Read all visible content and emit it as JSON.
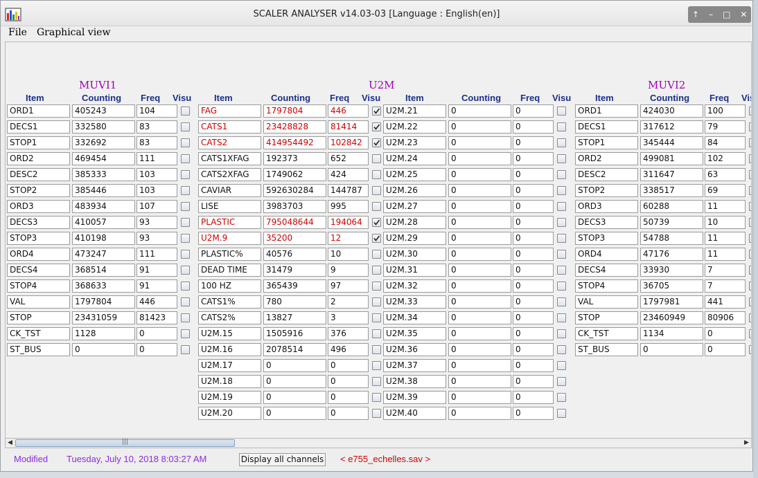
{
  "window": {
    "title": "SCALER ANALYSER v14.03-03 [Language : English(en)]"
  },
  "menu": {
    "file": "File",
    "graphical_view": "Graphical view"
  },
  "groups": [
    {
      "title": "MUVI1",
      "headers": {
        "item": "Item",
        "counting": "Counting",
        "freq": "Freq",
        "visu": "Visu"
      }
    },
    {
      "title": "U2M",
      "headers": {
        "item": "Item",
        "counting": "Counting",
        "freq": "Freq",
        "visu": "Visu"
      },
      "headers2": {
        "item": "Item",
        "counting": "Counting",
        "freq": "Freq",
        "visu": "Visu"
      }
    },
    {
      "title": "MUVI2",
      "headers": {
        "item": "Item",
        "counting": "Counting",
        "freq": "Freq",
        "visu": "Visu"
      }
    }
  ],
  "colors": {
    "highlight": "#d00000",
    "group_title": "#a000b8",
    "header": "#1a2f8c",
    "status_date": "#8a2be2",
    "filename": "#d00000"
  },
  "muvi1": [
    {
      "item": "ORD1",
      "counting": "405243",
      "freq": "104",
      "visu": false
    },
    {
      "item": "DECS1",
      "counting": "332580",
      "freq": "83",
      "visu": false
    },
    {
      "item": "STOP1",
      "counting": "332692",
      "freq": "83",
      "visu": false
    },
    {
      "item": "ORD2",
      "counting": "469454",
      "freq": "111",
      "visu": false
    },
    {
      "item": "DESC2",
      "counting": "385333",
      "freq": "103",
      "visu": false
    },
    {
      "item": "STOP2",
      "counting": "385446",
      "freq": "103",
      "visu": false
    },
    {
      "item": "ORD3",
      "counting": "483934",
      "freq": "107",
      "visu": false
    },
    {
      "item": "DECS3",
      "counting": "410057",
      "freq": "93",
      "visu": false
    },
    {
      "item": "STOP3",
      "counting": "410198",
      "freq": "93",
      "visu": false
    },
    {
      "item": "ORD4",
      "counting": "473247",
      "freq": "111",
      "visu": false
    },
    {
      "item": "DECS4",
      "counting": "368514",
      "freq": "91",
      "visu": false
    },
    {
      "item": "STOP4",
      "counting": "368633",
      "freq": "91",
      "visu": false
    },
    {
      "item": "VAL",
      "counting": "1797804",
      "freq": "446",
      "visu": false
    },
    {
      "item": "STOP",
      "counting": "23431059",
      "freq": "81423",
      "visu": false
    },
    {
      "item": "CK_TST",
      "counting": "1128",
      "freq": "0",
      "visu": false
    },
    {
      "item": "ST_BUS",
      "counting": "0",
      "freq": "0",
      "visu": false
    }
  ],
  "u2m_a": [
    {
      "item": "FAG",
      "counting": "1797804",
      "freq": "446",
      "visu": true,
      "red": true
    },
    {
      "item": "CATS1",
      "counting": "23428828",
      "freq": "81414",
      "visu": true,
      "red": true
    },
    {
      "item": "CATS2",
      "counting": "414954492",
      "freq": "102842",
      "visu": true,
      "red": true
    },
    {
      "item": "CATS1XFAG",
      "counting": "192373",
      "freq": "652",
      "visu": false
    },
    {
      "item": "CATS2XFAG",
      "counting": "1749062",
      "freq": "424",
      "visu": false
    },
    {
      "item": "CAVIAR",
      "counting": "592630284",
      "freq": "144787",
      "visu": false
    },
    {
      "item": "LISE",
      "counting": "3983703",
      "freq": "995",
      "visu": false
    },
    {
      "item": "PLASTIC",
      "counting": "795048644",
      "freq": "194064",
      "visu": true,
      "red": true
    },
    {
      "item": "U2M.9",
      "counting": "35200",
      "freq": "12",
      "visu": true,
      "red": true
    },
    {
      "item": "PLASTIC%",
      "counting": "40576",
      "freq": "10",
      "visu": false
    },
    {
      "item": "DEAD TIME",
      "counting": "31479",
      "freq": "9",
      "visu": false
    },
    {
      "item": "100 HZ",
      "counting": "365439",
      "freq": "97",
      "visu": false
    },
    {
      "item": "CATS1%",
      "counting": "780",
      "freq": "2",
      "visu": false
    },
    {
      "item": "CATS2%",
      "counting": "13827",
      "freq": "3",
      "visu": false
    },
    {
      "item": "U2M.15",
      "counting": "1505916",
      "freq": "376",
      "visu": false
    },
    {
      "item": "U2M.16",
      "counting": "2078514",
      "freq": "496",
      "visu": false
    },
    {
      "item": "U2M.17",
      "counting": "0",
      "freq": "0",
      "visu": false
    },
    {
      "item": "U2M.18",
      "counting": "0",
      "freq": "0",
      "visu": false
    },
    {
      "item": "U2M.19",
      "counting": "0",
      "freq": "0",
      "visu": false
    },
    {
      "item": "U2M.20",
      "counting": "0",
      "freq": "0",
      "visu": false
    }
  ],
  "u2m_b": [
    {
      "item": "U2M.21",
      "counting": "0",
      "freq": "0",
      "visu": false
    },
    {
      "item": "U2M.22",
      "counting": "0",
      "freq": "0",
      "visu": false
    },
    {
      "item": "U2M.23",
      "counting": "0",
      "freq": "0",
      "visu": false
    },
    {
      "item": "U2M.24",
      "counting": "0",
      "freq": "0",
      "visu": false
    },
    {
      "item": "U2M.25",
      "counting": "0",
      "freq": "0",
      "visu": false
    },
    {
      "item": "U2M.26",
      "counting": "0",
      "freq": "0",
      "visu": false
    },
    {
      "item": "U2M.27",
      "counting": "0",
      "freq": "0",
      "visu": false
    },
    {
      "item": "U2M.28",
      "counting": "0",
      "freq": "0",
      "visu": false
    },
    {
      "item": "U2M.29",
      "counting": "0",
      "freq": "0",
      "visu": false
    },
    {
      "item": "U2M.30",
      "counting": "0",
      "freq": "0",
      "visu": false
    },
    {
      "item": "U2M.31",
      "counting": "0",
      "freq": "0",
      "visu": false
    },
    {
      "item": "U2M.32",
      "counting": "0",
      "freq": "0",
      "visu": false
    },
    {
      "item": "U2M.33",
      "counting": "0",
      "freq": "0",
      "visu": false
    },
    {
      "item": "U2M.34",
      "counting": "0",
      "freq": "0",
      "visu": false
    },
    {
      "item": "U2M.35",
      "counting": "0",
      "freq": "0",
      "visu": false
    },
    {
      "item": "U2M.36",
      "counting": "0",
      "freq": "0",
      "visu": false
    },
    {
      "item": "U2M.37",
      "counting": "0",
      "freq": "0",
      "visu": false
    },
    {
      "item": "U2M.38",
      "counting": "0",
      "freq": "0",
      "visu": false
    },
    {
      "item": "U2M.39",
      "counting": "0",
      "freq": "0",
      "visu": false
    },
    {
      "item": "U2M.40",
      "counting": "0",
      "freq": "0",
      "visu": false
    }
  ],
  "muvi2": [
    {
      "item": "ORD1",
      "counting": "424030",
      "freq": "100",
      "visu": false
    },
    {
      "item": "DECS1",
      "counting": "317612",
      "freq": "79",
      "visu": false
    },
    {
      "item": "STOP1",
      "counting": "345444",
      "freq": "84",
      "visu": false
    },
    {
      "item": "ORD2",
      "counting": "499081",
      "freq": "102",
      "visu": false
    },
    {
      "item": "DESC2",
      "counting": "311647",
      "freq": "63",
      "visu": false
    },
    {
      "item": "STOP2",
      "counting": "338517",
      "freq": "69",
      "visu": false
    },
    {
      "item": "ORD3",
      "counting": "60288",
      "freq": "11",
      "visu": false
    },
    {
      "item": "DECS3",
      "counting": "50739",
      "freq": "10",
      "visu": false
    },
    {
      "item": "STOP3",
      "counting": "54788",
      "freq": "11",
      "visu": false
    },
    {
      "item": "ORD4",
      "counting": "47176",
      "freq": "11",
      "visu": false
    },
    {
      "item": "DECS4",
      "counting": "33930",
      "freq": "7",
      "visu": false
    },
    {
      "item": "STOP4",
      "counting": "36705",
      "freq": "7",
      "visu": false
    },
    {
      "item": "VAL",
      "counting": "1797981",
      "freq": "441",
      "visu": false
    },
    {
      "item": "STOP",
      "counting": "23460949",
      "freq": "80906",
      "visu": false
    },
    {
      "item": "CK_TST",
      "counting": "1134",
      "freq": "0",
      "visu": false
    },
    {
      "item": "ST_BUS",
      "counting": "0",
      "freq": "0",
      "visu": false
    }
  ],
  "status": {
    "modified": "Modified",
    "date": "Tuesday, July 10, 2018 8:03:27 AM",
    "display_all": "Display all channels",
    "filename": "< e755_echelles.sav >"
  },
  "icons": {
    "app": "bar-chart-icon",
    "window_controls": [
      "up-icon",
      "minimize-icon",
      "maximize-icon",
      "close-icon"
    ]
  }
}
